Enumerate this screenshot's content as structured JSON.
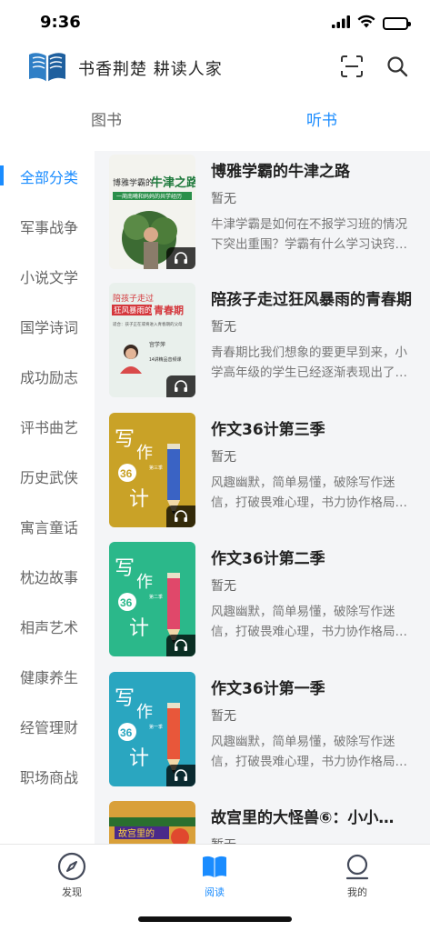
{
  "status": {
    "time": "9:36"
  },
  "header": {
    "title": "书香荆楚 耕读人家",
    "logo_icon": "open-book-logo",
    "scan_icon": "scan-icon",
    "search_icon": "search-icon"
  },
  "tabs": [
    {
      "label": "图书",
      "active": false
    },
    {
      "label": "听书",
      "active": true
    }
  ],
  "categories": [
    {
      "label": "全部分类",
      "active": true
    },
    {
      "label": "军事战争"
    },
    {
      "label": "小说文学"
    },
    {
      "label": "国学诗词"
    },
    {
      "label": "成功励志"
    },
    {
      "label": "评书曲艺"
    },
    {
      "label": "历史武侠"
    },
    {
      "label": "寓言童话"
    },
    {
      "label": "枕边故事"
    },
    {
      "label": "相声艺术"
    },
    {
      "label": "健康养生"
    },
    {
      "label": "经管理财"
    },
    {
      "label": "职场商战"
    }
  ],
  "books": [
    {
      "title": "博雅学霸的牛津之路",
      "author": "暂无",
      "desc": "牛津学霸是如何在不报学习班的情况下突出重围？学霸有什么学习诀窍…",
      "cover_text": [
        "博雅学霸的",
        "牛津之路",
        "一蔺南曦和妈妈的共学经历"
      ]
    },
    {
      "title": "陪孩子走过狂风暴雨的青春期",
      "author": "暂无",
      "desc": "青春期比我们想象的要更早到来，小学高年级的学生已经逐渐表现出了…",
      "cover_text": [
        "陪孩子走过",
        "狂风暴雨的",
        "青春期",
        "宫学萍",
        "适合：孩子正在或将进入青春期的父母",
        "14讲精品音频课"
      ]
    },
    {
      "title": "作文36计第三季",
      "author": "暂无",
      "desc": "风趣幽默，简单易懂，破除写作迷信，打破畏难心理，书力协作格局…",
      "cover_text": [
        "写",
        "作",
        "36",
        "计",
        "第三季"
      ]
    },
    {
      "title": "作文36计第二季",
      "author": "暂无",
      "desc": "风趣幽默，简单易懂，破除写作迷信，打破畏难心理，书力协作格局…",
      "cover_text": [
        "写",
        "作",
        "36",
        "计",
        "第二季"
      ]
    },
    {
      "title": "作文36计第一季",
      "author": "暂无",
      "desc": "风趣幽默，简单易懂，破除写作迷信，打破畏难心理，书力协作格局…",
      "cover_text": [
        "写",
        "作",
        "36",
        "计",
        "第一季"
      ]
    },
    {
      "title": "故宫里的大怪兽⑥：小小…",
      "author": "暂无",
      "desc": "",
      "cover_text": [
        "故宫里的"
      ]
    }
  ],
  "bottom_nav": [
    {
      "label": "发现",
      "icon": "compass-icon",
      "active": false
    },
    {
      "label": "阅读",
      "icon": "book-icon",
      "active": true
    },
    {
      "label": "我的",
      "icon": "profile-icon",
      "active": false
    }
  ],
  "colors": {
    "accent": "#1a8cff",
    "cover_yellow": "#c9a227",
    "cover_green": "#2bb88a",
    "cover_teal": "#2aa6c0"
  }
}
